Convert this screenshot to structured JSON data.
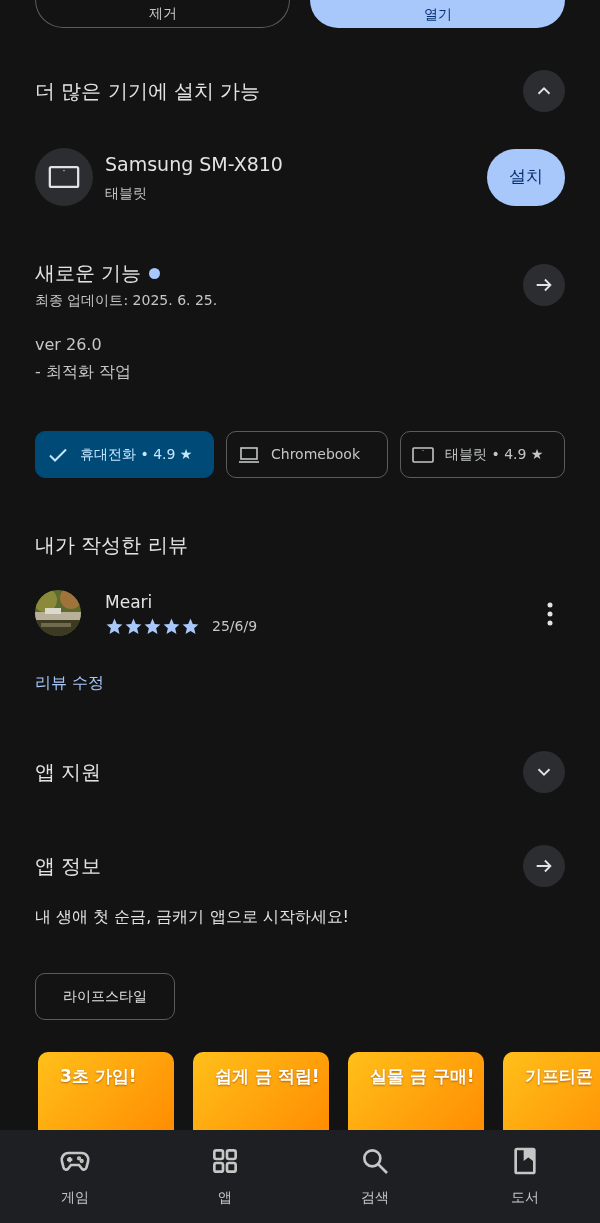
{
  "top_buttons": [
    {
      "label": "제거",
      "kind": "outline"
    },
    {
      "label": "열기",
      "kind": "filled"
    }
  ],
  "more_devices": {
    "title": "더 많은 기기에 설치 가능",
    "expanded": true,
    "device": {
      "name": "Samsung SM-X810",
      "type": "태블릿",
      "button": "설치"
    }
  },
  "whats_new": {
    "title": "새로운 기능",
    "new": true,
    "updated": "최종 업데이트: 2025. 6. 25.",
    "lines": [
      "ver 26.0",
      "- 최적화 작업"
    ]
  },
  "device_chips": [
    {
      "kind": "phone",
      "label": "휴대전화 • 4.9 ★",
      "selected": true
    },
    {
      "kind": "laptop",
      "label": "Chromebook",
      "selected": false
    },
    {
      "kind": "tablet",
      "label": "태블릿 • 4.9 ★",
      "selected": false
    }
  ],
  "my_review": {
    "title": "내가 작성한 리뷰",
    "author": "Meari",
    "stars": 5,
    "date": "25/6/9",
    "edit_link": "리뷰 수정"
  },
  "app_support": {
    "title": "앱 지원",
    "expanded": false
  },
  "app_info": {
    "title": "앱 정보",
    "description": "내 생애 첫 순금, 금캐기 앱으로 시작하세요!",
    "category": "라이프스타일"
  },
  "screenshots": [
    {
      "caption": "3초 가입!"
    },
    {
      "caption": "쉽게 금 적립!"
    },
    {
      "caption": "실물 금 구매!"
    },
    {
      "caption": "기프티콘"
    }
  ],
  "bottom_nav": [
    {
      "kind": "games",
      "label": "게임"
    },
    {
      "kind": "apps",
      "label": "앱"
    },
    {
      "kind": "search",
      "label": "검색"
    },
    {
      "kind": "books",
      "label": "도서"
    }
  ]
}
